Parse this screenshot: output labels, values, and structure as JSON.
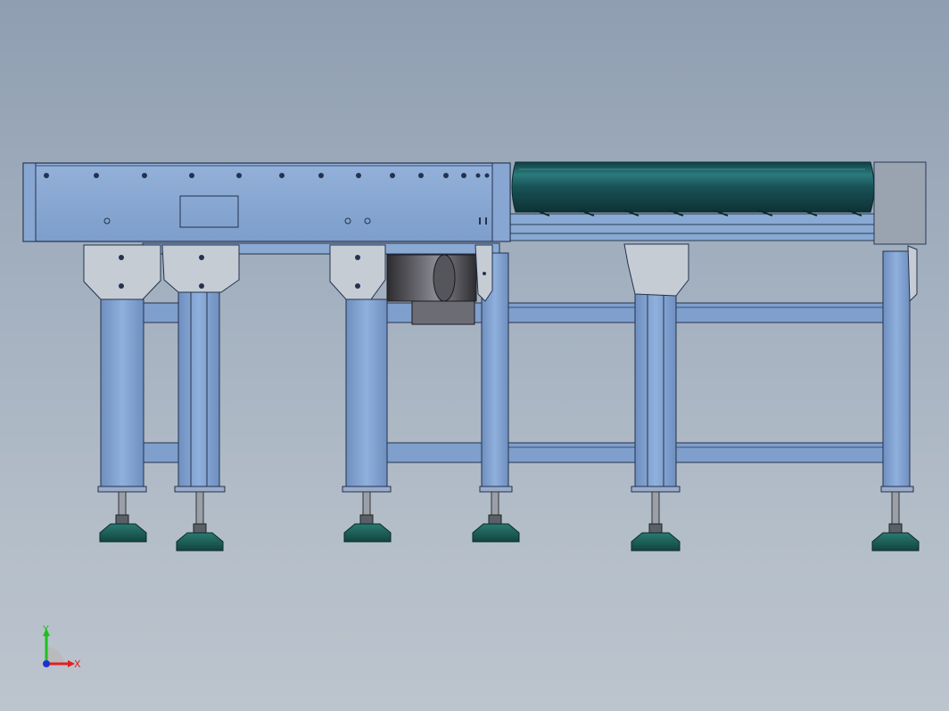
{
  "viewport": {
    "background_top": "#8f9eb1",
    "background_bottom": "#bcc4cd"
  },
  "model": {
    "frame_color": "#7f9fcd",
    "frame_dark": "#5a76a8",
    "roller_color": "#1b5a5e",
    "foot_color": "#1c5f5a",
    "gusset_color": "#c8cdd4",
    "motor_color": "#3e3e44"
  },
  "triad": {
    "x_label": "X",
    "y_label": "Y",
    "x_color": "#e02020",
    "y_color": "#1fbf1f",
    "z_color": "#2030d0"
  }
}
